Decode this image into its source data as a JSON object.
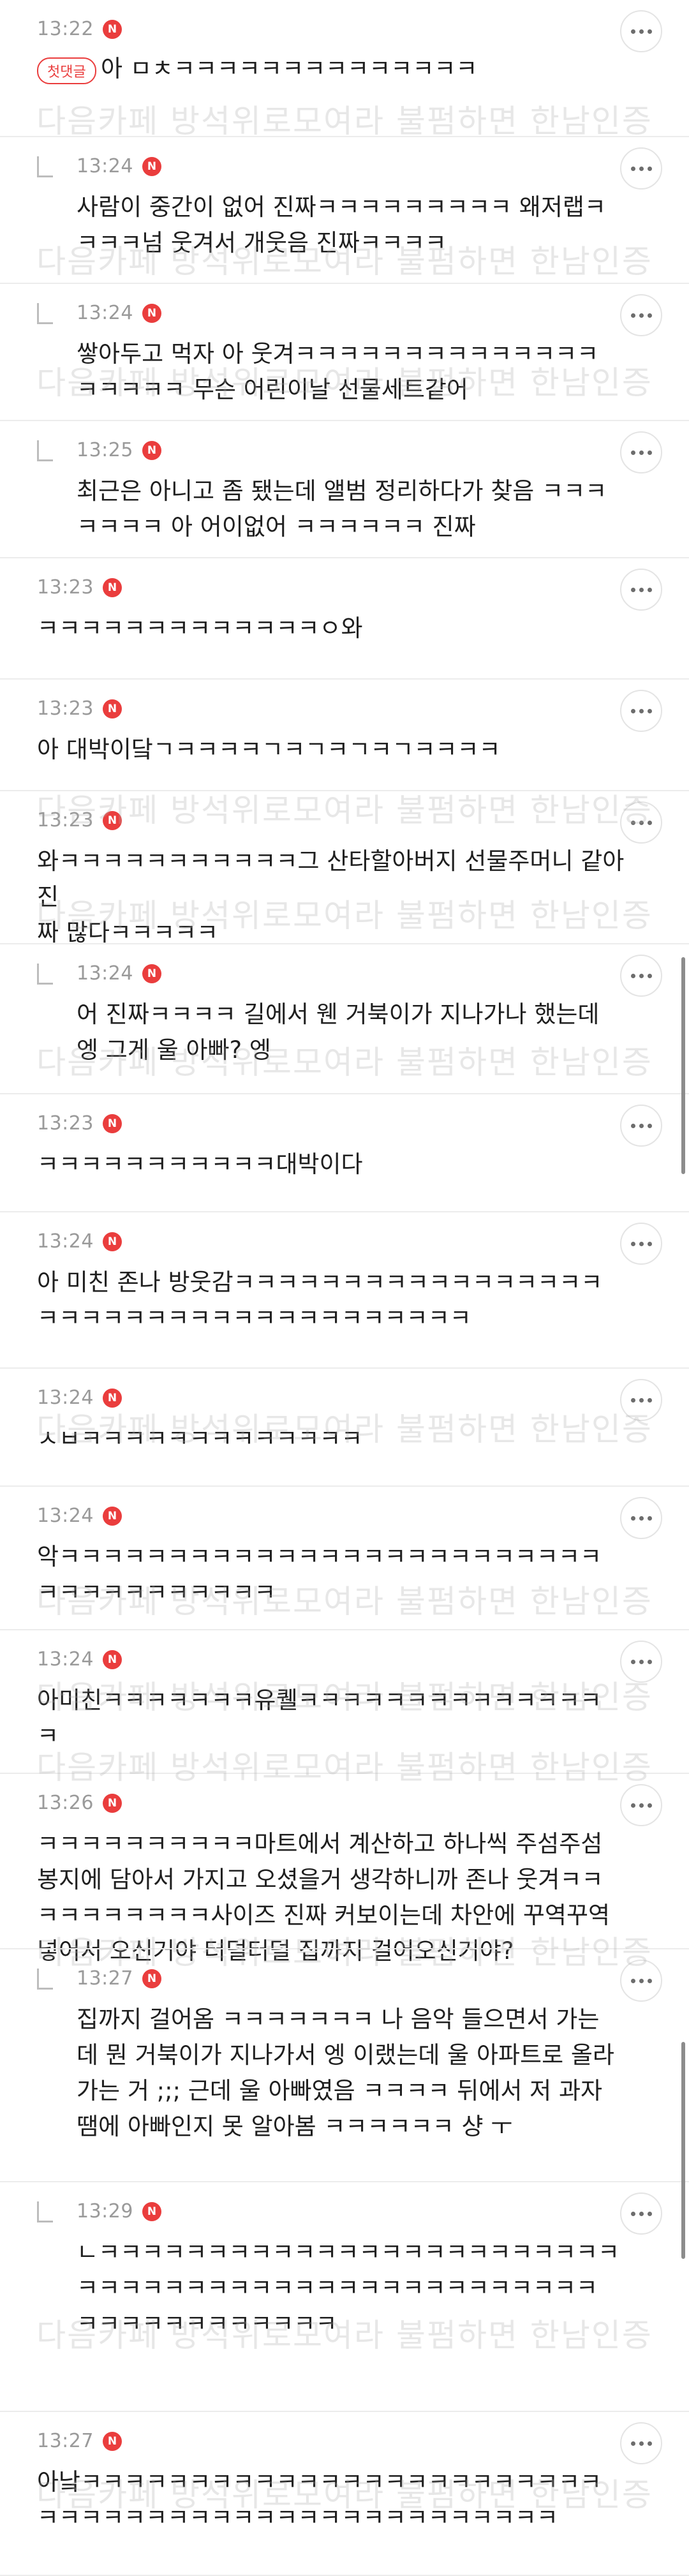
{
  "watermark_text": "다음카페 방석위로모여라 불펌하면 한남인증",
  "first_comment_badge": "첫댓글",
  "comments": [
    {
      "time": "13:22",
      "badge": "N",
      "reply": false,
      "first": true,
      "lines": [
        "아 ㅁㅊㅋㅋㅋㅋㅋㅋㅋㅋㅋㅋㅋㅋㅋㅋ"
      ]
    },
    {
      "time": "13:24",
      "badge": "N",
      "reply": true,
      "lines": [
        "사람이 중간이 없어 진짜ㅋㅋㅋㅋㅋㅋㅋㅋㅋ 왜저랩ㅋ",
        "ㅋㅋㅋ넘 웃겨서 개웃음 진짜ㅋㅋㅋㅋ"
      ]
    },
    {
      "time": "13:24",
      "badge": "N",
      "reply": true,
      "lines": [
        "쌓아두고 먹자 아 웃겨ㅋㅋㅋㅋㅋㅋㅋㅋㅋㅋㅋㅋㅋㅋ",
        "ㅋㅋㅋㅋㅋ 무슨 어린이날 선물세트같어"
      ]
    },
    {
      "time": "13:25",
      "badge": "N",
      "reply": true,
      "lines": [
        "최근은 아니고 좀 됐는데 앨범 정리하다가 찾음 ㅋㅋㅋ",
        "ㅋㅋㅋㅋ 아 어이없어 ㅋㅋㅋㅋㅋㅋ 진짜"
      ]
    },
    {
      "time": "13:23",
      "badge": "N",
      "reply": false,
      "lines": [
        "ㅋㅋㅋㅋㅋㅋㅋㅋㅋㅋㅋㅋㅋㅇ와"
      ]
    },
    {
      "time": "13:23",
      "badge": "N",
      "reply": false,
      "lines": [
        "아 대박이닼ㄱㅋㅋㅋㅋㄱㅋㄱㅋㄱㅋㄱㅋㅋㅋㅋ"
      ]
    },
    {
      "time": "13:23",
      "badge": "N",
      "reply": false,
      "lines": [
        "와ㅋㅋㅋㅋㅋㅋㅋㅋㅋㅋㅋ그 산타할아버지 선물주머니 같아 진",
        "짜 많다ㅋㅋㅋㅋㅋ"
      ]
    },
    {
      "time": "13:24",
      "badge": "N",
      "reply": true,
      "lines": [
        "어 진짜ㅋㅋㅋㅋ 길에서 웬 거북이가 지나가나 했는데",
        "엥 그게 울 아빠? 엥"
      ]
    },
    {
      "time": "13:23",
      "badge": "N",
      "reply": false,
      "lines": [
        "ㅋㅋㅋㅋㅋㅋㅋㅋㅋㅋㅋ대박이다"
      ]
    },
    {
      "time": "13:24",
      "badge": "N",
      "reply": false,
      "lines": [
        "아 미친 존나 방웃감ㅋㅋㅋㅋㅋㅋㅋㅋㅋㅋㅋㅋㅋㅋㅋㅋㅋ",
        "ㅋㅋㅋㅋㅋㅋㅋㅋㅋㅋㅋㅋㅋㅋㅋㅋㅋㅋㅋㅋ"
      ]
    },
    {
      "time": "13:24",
      "badge": "N",
      "reply": false,
      "lines": [
        "ㅅㅂㅋㅋㅋㅋㅋㅋㅋㅋㅋㅋㅋㅋㅋ"
      ]
    },
    {
      "time": "13:24",
      "badge": "N",
      "reply": false,
      "lines": [
        "악ㅋㅋㅋㅋㅋㅋㅋㅋㅋㅋㅋㅋㅋㅋㅋㅋㅋㅋㅋㅋㅋㅋㅋㅋㅋ",
        "ㅋㅋㅋㅋㅋㅋㅋㅋㅋㅋㅋ"
      ]
    },
    {
      "time": "13:24",
      "badge": "N",
      "reply": false,
      "lines": [
        "아미친ㅋㅋㅋㅋㅋㅋㅋ유퀠ㅋㅋㅋㅋㅋㅋㅋㅋㅋㅋㅋㅋㅋㅋ",
        "ㅋ"
      ]
    },
    {
      "time": "13:26",
      "badge": "N",
      "reply": false,
      "lines": [
        "ㅋㅋㅋㅋㅋㅋㅋㅋㅋㅋ마트에서 계산하고 하나씩 주섬주섬",
        "봉지에 담아서 가지고 오셨을거 생각하니까 존나 웃겨ㅋㅋ",
        "ㅋㅋㅋㅋㅋㅋㅋㅋ사이즈 진짜 커보이는데 차안에 꾸역꾸역",
        "넣어서 오신거야 터덜터덜 집까지 걸어오신거야?"
      ]
    },
    {
      "time": "13:27",
      "badge": "N",
      "reply": true,
      "lines": [
        "집까지 걸어옴 ㅋㅋㅋㅋㅋㅋㅋ 나 음악 들으면서 가는",
        "데 뭔 거북이가 지나가서 엥 이랬는데 울 아파트로 올라",
        "가는 거 ;;; 근데 울 아빠였음 ㅋㅋㅋㅋ 뒤에서 저 과자",
        "땜에 아빠인지 못 알아봄 ㅋㅋㅋㅋㅋㅋ 샹 ㅜ"
      ]
    },
    {
      "time": "13:29",
      "badge": "N",
      "reply": true,
      "lines": [
        "ㄴㅋㅋㅋㅋㅋㅋㅋㅋㅋㅋㅋㅋㅋㅋㅋㅋㅋㅋㅋㅋㅋㅋㅋㅋ",
        "ㅋㅋㅋㅋㅋㅋㅋㅋㅋㅋㅋㅋㅋㅋㅋㅋㅋㅋㅋㅋㅋㅋㅋㅋ",
        "ㅋㅋㅋㅋㅋㅋㅋㅋㅋㅋㅋㅋ"
      ]
    },
    {
      "time": "13:27",
      "badge": "N",
      "reply": false,
      "lines": [
        "아낰ㅋㅋㅋㅋㅋㅋㅋㅋㅋㅋㅋㅋㅋㅋㅋㅋㅋㅋㅋㅋㅋㅋㅋㅋ",
        "ㅋㅋㅋㅋㅋㅋㅋㅋㅋㅋㅋㅋㅋㅋㅋㅋㅋㅋㅋㅋㅋㅋㅋㅋ"
      ]
    }
  ]
}
